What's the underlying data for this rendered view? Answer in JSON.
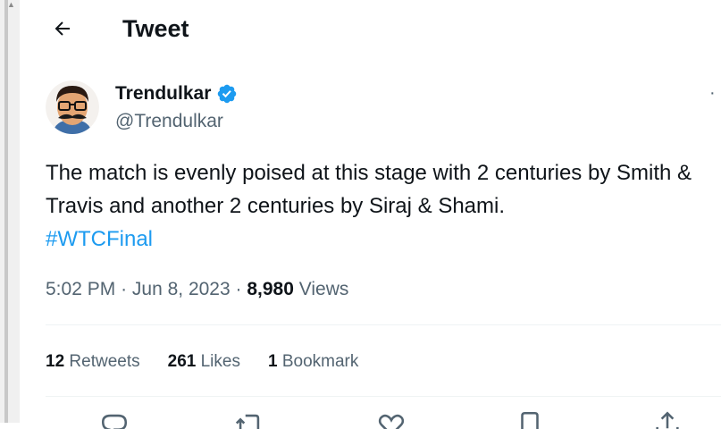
{
  "header": {
    "title": "Tweet",
    "back_icon": "arrow-left-icon"
  },
  "author": {
    "name": "Trendulkar",
    "handle": "@Trendulkar",
    "verified_icon": "verified-badge-icon",
    "verified_color": "#1d9bf0",
    "more_label": "·"
  },
  "tweet": {
    "text": "The match is evenly poised at this stage with 2 centuries by Smith & Travis and another 2 centuries by Siraj & Shami.",
    "hashtag": "#WTCFinal",
    "hashtag_color": "#1d9bf0"
  },
  "meta": {
    "time": "5:02 PM",
    "separator": "·",
    "date": "Jun 8, 2023",
    "views_count": "8,980",
    "views_label": "Views"
  },
  "stats": {
    "retweets_count": "12",
    "retweets_label": "Retweets",
    "likes_count": "261",
    "likes_label": "Likes",
    "bookmarks_count": "1",
    "bookmarks_label": "Bookmark"
  },
  "actions": {
    "icons": [
      "reply-icon",
      "retweet-icon",
      "like-icon",
      "bookmark-icon",
      "share-icon"
    ]
  }
}
